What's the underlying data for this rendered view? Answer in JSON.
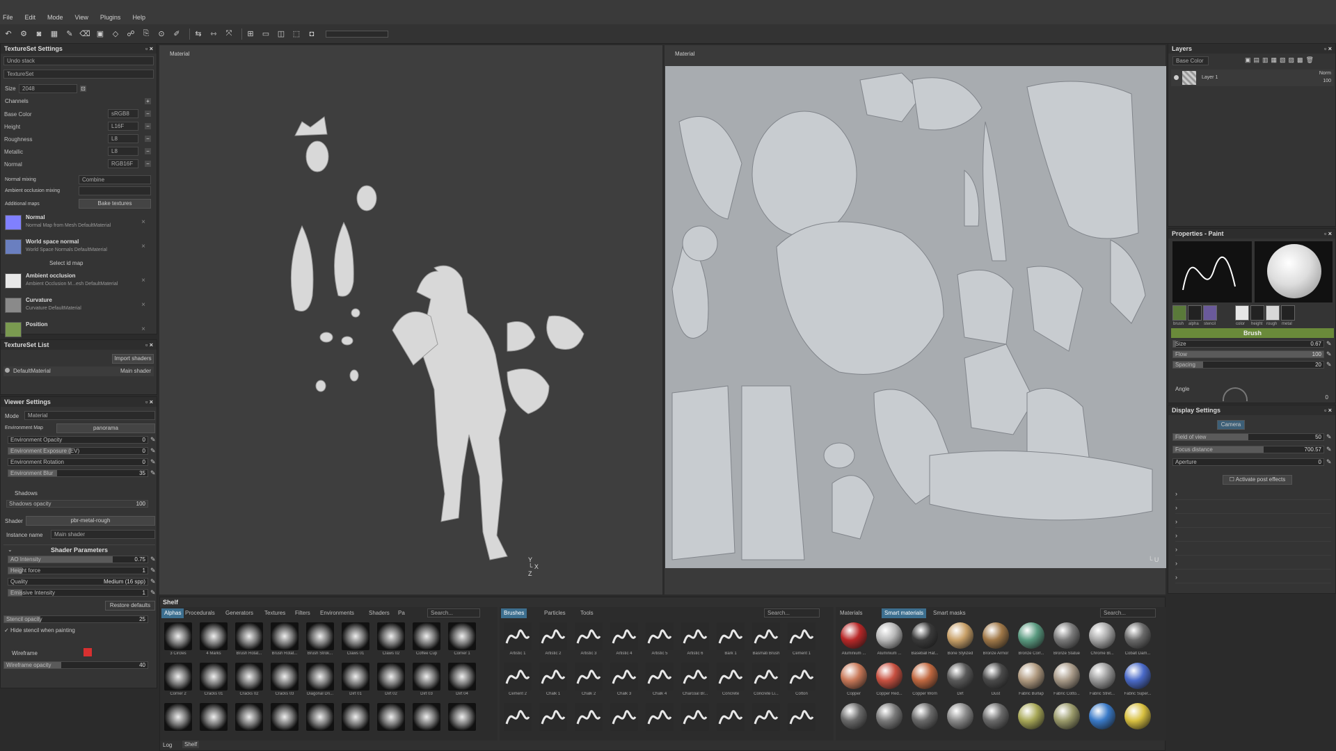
{
  "menu": [
    "File",
    "Edit",
    "Mode",
    "View",
    "Plugins",
    "Help"
  ],
  "left": {
    "textureset_settings": {
      "title": "TextureSet Settings",
      "undo": "Undo stack",
      "textureset": "TextureSet",
      "size_label": "Size",
      "size_value": "2048",
      "channels_label": "Channels",
      "channels": [
        {
          "name": "Base Color",
          "fmt": "sRGB8"
        },
        {
          "name": "Height",
          "fmt": "L16F"
        },
        {
          "name": "Roughness",
          "fmt": "L8"
        },
        {
          "name": "Metallic",
          "fmt": "L8"
        },
        {
          "name": "Normal",
          "fmt": "RGB16F"
        }
      ],
      "normal_mixing_label": "Normal mixing",
      "normal_mixing_value": "Combine",
      "ao_mixing_label": "Ambient occlusion mixing",
      "additional_maps_label": "Additional maps",
      "bake_button": "Bake textures",
      "maps": [
        {
          "name": "Normal",
          "sub": "Normal Map from Mesh DefaultMaterial",
          "color": "#8080ff"
        },
        {
          "name": "World space normal",
          "sub": "World Space Normals DefaultMaterial",
          "color": "#6a7fc0"
        },
        {
          "name": "Ambient occlusion",
          "sub": "Ambient Occlusion M...esh DefaultMaterial",
          "color": "#e8e8e8"
        },
        {
          "name": "Curvature",
          "sub": "Curvature DefaultMaterial",
          "color": "#8a8a8a"
        },
        {
          "name": "Position",
          "sub": "",
          "color": "#7a9a50"
        }
      ],
      "select_id": "Select id map"
    },
    "textureset_list": {
      "title": "TextureSet List",
      "import_shaders": "Import shaders",
      "item": "DefaultMaterial",
      "shader": "Main shader"
    },
    "viewer": {
      "title": "Viewer Settings",
      "mode_label": "Mode",
      "mode_value": "Material",
      "env_map_label": "Environment Map",
      "env_map_value": "panorama",
      "sliders": [
        {
          "label": "Environment Opacity",
          "value": "0",
          "fill": 0.0
        },
        {
          "label": "Environment Exposure (EV)",
          "value": "0",
          "fill": 0.45
        },
        {
          "label": "Environment Rotation",
          "value": "0",
          "fill": 0.0
        },
        {
          "label": "Environment Blur",
          "value": "35",
          "fill": 0.35
        }
      ],
      "shadows_label": "Shadows",
      "shadows_opacity": "Shadows opacity",
      "shadows_opacity_value": "100",
      "shader_label": "Shader",
      "shader_value": "pbr-metal-rough",
      "instance_label": "Instance name",
      "instance_value": "Main shader",
      "shader_params": "Shader Parameters",
      "params": [
        {
          "label": "AO Intensity",
          "value": "0.75",
          "fill": 0.75
        },
        {
          "label": "Height force",
          "value": "1",
          "fill": 0.1
        },
        {
          "label": "Quality",
          "value": "Medium (16 spp)",
          "fill": 0
        },
        {
          "label": "Emissive Intensity",
          "value": "1",
          "fill": 0.1
        }
      ],
      "restore": "Restore defaults",
      "stencil_opacity": "Stencil opacity",
      "stencil_value": "25",
      "hide_stencil": "Hide stencil when painting",
      "wireframe": "Wireframe",
      "wireframe_opacity": "Wireframe opacity",
      "wireframe_opacity_value": "40"
    }
  },
  "viewport3d": {
    "title": "Material"
  },
  "viewport2d": {
    "title": "Material"
  },
  "layers": {
    "title": "Layers",
    "blend": "Base Color",
    "layer_name": "Layer 1",
    "layer_mode": "Norm",
    "layer_opacity": "100"
  },
  "properties": {
    "title": "Properties - Paint",
    "swatches": [
      {
        "label": "brush",
        "color": "#5a7a3a"
      },
      {
        "label": "alpha",
        "color": "#222"
      },
      {
        "label": "stencil",
        "color": "#6a5a9a"
      },
      {
        "label": "color",
        "color": "#e6e6e6"
      },
      {
        "label": "height",
        "color": "#222"
      },
      {
        "label": "rough",
        "color": "#d8d8d8"
      },
      {
        "label": "metal",
        "color": "#222"
      }
    ],
    "brush_header": "Brush",
    "brush": [
      {
        "label": "Size",
        "value": "0.67",
        "fill": 0.02
      },
      {
        "label": "Flow",
        "value": "100",
        "fill": 1.0
      },
      {
        "label": "Spacing",
        "value": "20",
        "fill": 0.2
      }
    ],
    "angle_label": "Angle",
    "angle_value": "0"
  },
  "display": {
    "title": "Display Settings",
    "camera": "Camera",
    "params": [
      {
        "label": "Field of view",
        "value": "50",
        "fill": 0.5
      },
      {
        "label": "Focus distance",
        "value": "700.57",
        "fill": 0.6
      },
      {
        "label": "Aperture",
        "value": "0",
        "fill": 0.0
      }
    ],
    "post_effects": "Activate post effects"
  },
  "shelf": {
    "title": "Shelf",
    "tabs1": [
      "Alphas",
      "Procedurals",
      "Generators",
      "Textures",
      "Filters",
      "Environments",
      "Shaders",
      "Pa"
    ],
    "search": "Search...",
    "alphas": [
      "3 Circles",
      "4 Marks",
      "Brush Rotat...",
      "Brush Rotat...",
      "Brush Strok...",
      "Claws 01",
      "Claws 02",
      "Coffee Cup",
      "Corner 1",
      "Corner 2",
      "Cracks 01",
      "Cracks 02",
      "Cracks 03",
      "Diagonal Dri...",
      "Dirt 01",
      "Dirt 02",
      "Dirt 03",
      "Dirt 04",
      "",
      "",
      "",
      "",
      "",
      "",
      "",
      "",
      ""
    ],
    "tabs2": [
      "Brushes",
      "Particles",
      "Tools"
    ],
    "brushes": [
      "Artistic 1",
      "Artistic 2",
      "Artistic 3",
      "Artistic 4",
      "Artistic 5",
      "Artistic 6",
      "Bark 1",
      "Basmati Brush",
      "Cement 1",
      "Cement 2",
      "Chalk 1",
      "Chalk 2",
      "Chalk 3",
      "Chalk 4",
      "Charcoal Br...",
      "Concrete",
      "Concrete Li...",
      "Cotton",
      "",
      "",
      "",
      "",
      "",
      "",
      "",
      "",
      ""
    ],
    "tabs3": [
      "Materials",
      "Smart materials",
      "Smart masks"
    ],
    "materials": [
      {
        "n": "Aluminium ...",
        "c": "#b82828"
      },
      {
        "n": "Aluminium ...",
        "c": "#b8b8b8"
      },
      {
        "n": "Baseball Hat...",
        "c": "#3a3a3a"
      },
      {
        "n": "Bone Stylized",
        "c": "#c8a068"
      },
      {
        "n": "Bronze Armor",
        "c": "#a07848"
      },
      {
        "n": "Bronze Corr...",
        "c": "#5a9a80"
      },
      {
        "n": "Bronze Statue",
        "c": "#7a7a7a"
      },
      {
        "n": "Chrome Bl...",
        "c": "#a8a8a8"
      },
      {
        "n": "Cobalt Dam...",
        "c": "#6a6a6a"
      },
      {
        "n": "Copper",
        "c": "#c87858"
      },
      {
        "n": "Copper Red...",
        "c": "#c85040"
      },
      {
        "n": "Copper Worn",
        "c": "#c06840"
      },
      {
        "n": "Dirt",
        "c": "#5a5a5a"
      },
      {
        "n": "Dust",
        "c": "#4a4a4a"
      },
      {
        "n": "Fabric Burlap",
        "c": "#b09a80"
      },
      {
        "n": "Fabric Cotto...",
        "c": "#a89a88"
      },
      {
        "n": "Fabric Stret...",
        "c": "#9a9a9a"
      },
      {
        "n": "Fabric Super...",
        "c": "#4a6ac8"
      },
      {
        "n": "",
        "c": "#6a6a6a"
      },
      {
        "n": "",
        "c": "#7a7a7a"
      },
      {
        "n": "",
        "c": "#6a6a6a"
      },
      {
        "n": "",
        "c": "#8a8a8a"
      },
      {
        "n": "",
        "c": "#6a6a6a"
      },
      {
        "n": "",
        "c": "#a8a858"
      },
      {
        "n": "",
        "c": "#9a9a6a"
      },
      {
        "n": "",
        "c": "#3a7ac8"
      },
      {
        "n": "",
        "c": "#d8c040"
      }
    ],
    "log": "Log",
    "shelf_tab": "Shelf"
  }
}
